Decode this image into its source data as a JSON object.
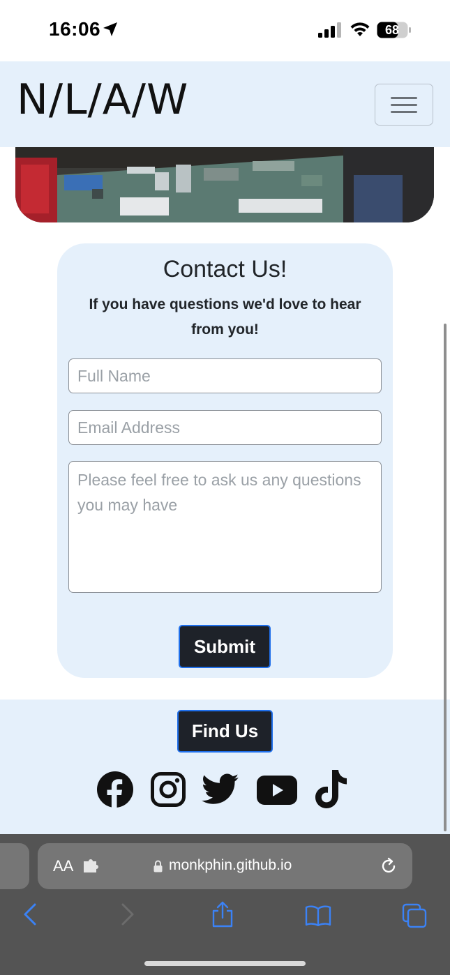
{
  "status_bar": {
    "time": "16:06",
    "battery_level": "68"
  },
  "navbar": {
    "brand": "N/L/A/W",
    "toggler_label": "Toggle navigation"
  },
  "contact": {
    "title": "Contact Us!",
    "subtitle": "If you have questions we'd love to hear from you!",
    "name_placeholder": "Full Name",
    "email_placeholder": "Email Address",
    "message_placeholder": "Please feel free to ask us any questions you may have",
    "submit_label": "Submit"
  },
  "footer": {
    "find_us_label": "Find Us",
    "social_icons": [
      "facebook-icon",
      "instagram-icon",
      "twitter-icon",
      "youtube-icon",
      "tiktok-icon"
    ]
  },
  "browser": {
    "aa_label": "AA",
    "url": "monkphin.github.io"
  },
  "colors": {
    "accent_bg": "#e5f0fb",
    "button_dark": "#1e2229",
    "button_border": "#1f6feb",
    "toolbar_blue": "#3b82f6"
  }
}
